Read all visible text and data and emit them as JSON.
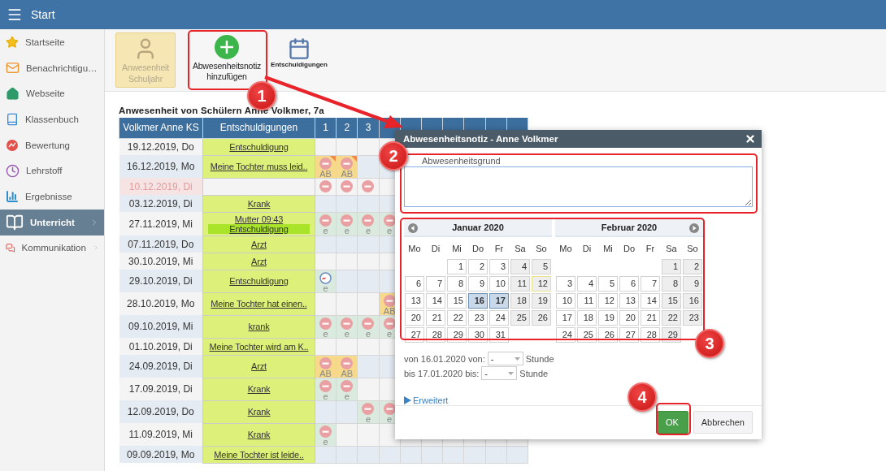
{
  "topbar": {
    "title": "Start"
  },
  "sidebar": {
    "items": [
      {
        "label": "Startseite",
        "selected": false,
        "has_submenu": false
      },
      {
        "label": "Benachrichtigu…",
        "selected": false,
        "has_submenu": false
      },
      {
        "label": "Webseite",
        "selected": false,
        "has_submenu": false
      },
      {
        "label": "Klassenbuch",
        "selected": false,
        "has_submenu": false
      },
      {
        "label": "Bewertung",
        "selected": false,
        "has_submenu": false
      },
      {
        "label": "Lehrstoff",
        "selected": false,
        "has_submenu": false
      },
      {
        "label": "Ergebnisse",
        "selected": false,
        "has_submenu": false
      },
      {
        "label": "Unterricht",
        "selected": true,
        "has_submenu": true
      },
      {
        "label": "Kommunikation",
        "selected": false,
        "has_submenu": true
      }
    ]
  },
  "toolbar": {
    "buttons": [
      {
        "lines": [
          "Anwesenheit",
          "Schuljahr"
        ],
        "disabled": true
      },
      {
        "lines": [
          "Abwesenheitsnotiz",
          "hinzufügen"
        ],
        "disabled": false
      },
      {
        "lines": [
          "Entschuldigungen"
        ],
        "disabled": false
      }
    ]
  },
  "table": {
    "title": "Anwesenheit von Schülern Anne Volkmer, 7a",
    "columns": [
      "Volkmer Anne KS",
      "Entschuldigungen"
    ],
    "periods": [
      "1",
      "2",
      "3"
    ],
    "rows": [
      {
        "date": "19.12.2019, Do",
        "flagged": false,
        "excuses": [
          {
            "text": "Entschuldigung",
            "highlighted": false
          }
        ]
      },
      {
        "date": "16.12.2019, Mo",
        "flagged": false,
        "excuses": [
          {
            "text": "Meine Tochter muss leid..",
            "highlighted": false
          }
        ],
        "marks": [
          {
            "kind": "absent",
            "color": "#f6d98b",
            "code": "AB",
            "note": true
          },
          {
            "kind": "absent",
            "color": "#f6d98b",
            "code": "AB",
            "note": true
          }
        ]
      },
      {
        "date": "10.12.2019, Di",
        "flagged": true,
        "marks": [
          {
            "kind": "absent"
          },
          {
            "kind": "absent"
          },
          {
            "kind": "absent"
          }
        ]
      },
      {
        "date": "03.12.2019, Di",
        "flagged": false,
        "excuses": [
          {
            "text": "Krank",
            "highlighted": false
          }
        ]
      },
      {
        "date": "27.11.2019, Mi",
        "flagged": false,
        "excuses": [
          {
            "text": "Mutter 09:43",
            "highlighted": false
          },
          {
            "text": "Entschuldigung",
            "highlighted": true
          }
        ],
        "marks": [
          {
            "kind": "absent",
            "color": "#dbeadf",
            "code": "e",
            "note": false
          },
          {
            "kind": "absent",
            "color": "#dbeadf",
            "code": "e",
            "note": false
          },
          {
            "kind": "absent",
            "color": "#dbeadf",
            "code": "e",
            "note": false
          },
          {
            "kind": "absent",
            "color": "#dbeadf",
            "code": "e",
            "note": false
          }
        ]
      },
      {
        "date": "07.11.2019, Do",
        "flagged": false,
        "excuses": [
          {
            "text": "Arzt",
            "highlighted": false
          }
        ]
      },
      {
        "date": "30.10.2019, Mi",
        "flagged": false,
        "excuses": [
          {
            "text": "Arzt",
            "highlighted": false
          }
        ]
      },
      {
        "date": "29.10.2019, Di",
        "flagged": false,
        "excuses": [
          {
            "text": "Entschuldigung",
            "highlighted": false
          }
        ],
        "marks": [
          {
            "kind": "late",
            "color": "#dbeadf",
            "code": "e",
            "note": false
          }
        ]
      },
      {
        "date": "28.10.2019, Mo",
        "flagged": false,
        "excuses": [
          {
            "text": "Meine Tochter hat einen..",
            "highlighted": false
          }
        ],
        "marks": [
          {
            "kind": "empty"
          },
          {
            "kind": "empty"
          },
          {
            "kind": "empty"
          },
          {
            "kind": "absent",
            "color": "#f6d98b",
            "code": "AB",
            "note": false
          }
        ]
      },
      {
        "date": "09.10.2019, Mi",
        "flagged": false,
        "excuses": [
          {
            "text": "krank",
            "highlighted": false
          }
        ],
        "marks": [
          {
            "kind": "absent",
            "color": "#dbeadf",
            "code": "e",
            "note": false
          },
          {
            "kind": "absent",
            "color": "#dbeadf",
            "code": "e",
            "note": false
          },
          {
            "kind": "absent",
            "color": "#dbeadf",
            "code": "e",
            "note": false
          },
          {
            "kind": "absent",
            "color": "#dbeadf",
            "code": "e",
            "note": false
          }
        ]
      },
      {
        "date": "01.10.2019, Di",
        "flagged": false,
        "excuses": [
          {
            "text": "Meine Tochter wird am K..",
            "highlighted": false
          }
        ]
      },
      {
        "date": "24.09.2019, Di",
        "flagged": false,
        "excuses": [
          {
            "text": "Arzt",
            "highlighted": false
          }
        ],
        "marks": [
          {
            "kind": "absent",
            "color": "#f6d98b",
            "code": "AB",
            "note": false
          },
          {
            "kind": "absent",
            "color": "#f6d98b",
            "code": "AB",
            "note": false
          }
        ]
      },
      {
        "date": "17.09.2019, Di",
        "flagged": false,
        "excuses": [
          {
            "text": "Krank",
            "highlighted": false
          }
        ],
        "marks": [
          {
            "kind": "absent",
            "color": "#dbeadf",
            "code": "e",
            "note": false
          },
          {
            "kind": "absent",
            "color": "#dbeadf",
            "code": "e",
            "note": false
          }
        ]
      },
      {
        "date": "12.09.2019, Do",
        "flagged": false,
        "excuses": [
          {
            "text": "Krank",
            "highlighted": false
          }
        ],
        "marks": [
          {
            "kind": "empty"
          },
          {
            "kind": "empty"
          },
          {
            "kind": "absent",
            "color": "#dbeadf",
            "code": "e",
            "note": false
          },
          {
            "kind": "absent",
            "color": "#dbeadf",
            "code": "e",
            "note": false
          }
        ]
      },
      {
        "date": "11.09.2019, Mi",
        "flagged": false,
        "excuses": [
          {
            "text": "Krank",
            "highlighted": false
          }
        ],
        "marks": [
          {
            "kind": "absent",
            "color": "#dbeadf",
            "code": "e",
            "note": false
          }
        ]
      },
      {
        "date": "09.09.2019, Mo",
        "flagged": false,
        "excuses": [
          {
            "text": "Meine Tochter ist leide..",
            "highlighted": false
          }
        ]
      }
    ]
  },
  "dialog": {
    "title": "Abwesenheitsnotiz - Anne Volkmer",
    "reason_label": "Abwesenheitsgrund",
    "calendar": {
      "months": [
        {
          "title": "Januar 2020",
          "weekdays": [
            "Mo",
            "Di",
            "Mi",
            "Do",
            "Fr",
            "Sa",
            "So"
          ],
          "weeks": [
            [
              {
                "kind": "blank"
              },
              {
                "kind": "blank"
              },
              {
                "kind": "day",
                "day": "1",
                "selected": false,
                "today": false
              },
              {
                "kind": "day",
                "day": "2",
                "selected": false,
                "today": false
              },
              {
                "kind": "day",
                "day": "3",
                "selected": false,
                "today": false
              },
              {
                "kind": "day",
                "day": "4",
                "selected": false,
                "today": false
              },
              {
                "kind": "day",
                "day": "5",
                "selected": false,
                "today": false
              }
            ],
            [
              {
                "kind": "day",
                "day": "6",
                "selected": false,
                "today": false
              },
              {
                "kind": "day",
                "day": "7",
                "selected": false,
                "today": false
              },
              {
                "kind": "day",
                "day": "8",
                "selected": false,
                "today": false
              },
              {
                "kind": "day",
                "day": "9",
                "selected": false,
                "today": false
              },
              {
                "kind": "day",
                "day": "10",
                "selected": false,
                "today": false
              },
              {
                "kind": "day",
                "day": "11",
                "selected": false,
                "today": false
              },
              {
                "kind": "day",
                "day": "12",
                "selected": false,
                "today": true
              }
            ],
            [
              {
                "kind": "day",
                "day": "13",
                "selected": false,
                "today": false
              },
              {
                "kind": "day",
                "day": "14",
                "selected": false,
                "today": false
              },
              {
                "kind": "day",
                "day": "15",
                "selected": false,
                "today": false
              },
              {
                "kind": "day",
                "day": "16",
                "selected": true,
                "today": false
              },
              {
                "kind": "day",
                "day": "17",
                "selected": true,
                "today": false
              },
              {
                "kind": "day",
                "day": "18",
                "selected": false,
                "today": false
              },
              {
                "kind": "day",
                "day": "19",
                "selected": false,
                "today": false
              }
            ],
            [
              {
                "kind": "day",
                "day": "20",
                "selected": false,
                "today": false
              },
              {
                "kind": "day",
                "day": "21",
                "selected": false,
                "today": false
              },
              {
                "kind": "day",
                "day": "22",
                "selected": false,
                "today": false
              },
              {
                "kind": "day",
                "day": "23",
                "selected": false,
                "today": false
              },
              {
                "kind": "day",
                "day": "24",
                "selected": false,
                "today": false
              },
              {
                "kind": "day",
                "day": "25",
                "selected": false,
                "today": false
              },
              {
                "kind": "day",
                "day": "26",
                "selected": false,
                "today": false
              }
            ],
            [
              {
                "kind": "day",
                "day": "27",
                "selected": false,
                "today": false
              },
              {
                "kind": "day",
                "day": "28",
                "selected": false,
                "today": false
              },
              {
                "kind": "day",
                "day": "29",
                "selected": false,
                "today": false
              },
              {
                "kind": "day",
                "day": "30",
                "selected": false,
                "today": false
              },
              {
                "kind": "day",
                "day": "31",
                "selected": false,
                "today": false
              },
              {
                "kind": "blank"
              },
              {
                "kind": "blank"
              }
            ]
          ]
        },
        {
          "title": "Februar 2020",
          "weekdays": [
            "Mo",
            "Di",
            "Mi",
            "Do",
            "Fr",
            "Sa",
            "So"
          ],
          "weeks": [
            [
              {
                "kind": "blank"
              },
              {
                "kind": "blank"
              },
              {
                "kind": "blank"
              },
              {
                "kind": "blank"
              },
              {
                "kind": "blank"
              },
              {
                "kind": "day",
                "day": "1",
                "selected": false,
                "today": false
              },
              {
                "kind": "day",
                "day": "2",
                "selected": false,
                "today": false
              }
            ],
            [
              {
                "kind": "day",
                "day": "3",
                "selected": false,
                "today": false
              },
              {
                "kind": "day",
                "day": "4",
                "selected": false,
                "today": false
              },
              {
                "kind": "day",
                "day": "5",
                "selected": false,
                "today": false
              },
              {
                "kind": "day",
                "day": "6",
                "selected": false,
                "today": false
              },
              {
                "kind": "day",
                "day": "7",
                "selected": false,
                "today": false
              },
              {
                "kind": "day",
                "day": "8",
                "selected": false,
                "today": false
              },
              {
                "kind": "day",
                "day": "9",
                "selected": false,
                "today": false
              }
            ],
            [
              {
                "kind": "day",
                "day": "10",
                "selected": false,
                "today": false
              },
              {
                "kind": "day",
                "day": "11",
                "selected": false,
                "today": false
              },
              {
                "kind": "day",
                "day": "12",
                "selected": false,
                "today": false
              },
              {
                "kind": "day",
                "day": "13",
                "selected": false,
                "today": false
              },
              {
                "kind": "day",
                "day": "14",
                "selected": false,
                "today": false
              },
              {
                "kind": "day",
                "day": "15",
                "selected": false,
                "today": false
              },
              {
                "kind": "day",
                "day": "16",
                "selected": false,
                "today": false
              }
            ],
            [
              {
                "kind": "day",
                "day": "17",
                "selected": false,
                "today": false
              },
              {
                "kind": "day",
                "day": "18",
                "selected": false,
                "today": false
              },
              {
                "kind": "day",
                "day": "19",
                "selected": false,
                "today": false
              },
              {
                "kind": "day",
                "day": "20",
                "selected": false,
                "today": false
              },
              {
                "kind": "day",
                "day": "21",
                "selected": false,
                "today": false
              },
              {
                "kind": "day",
                "day": "22",
                "selected": false,
                "today": false
              },
              {
                "kind": "day",
                "day": "23",
                "selected": false,
                "today": false
              }
            ],
            [
              {
                "kind": "day",
                "day": "24",
                "selected": false,
                "today": false
              },
              {
                "kind": "day",
                "day": "25",
                "selected": false,
                "today": false
              },
              {
                "kind": "day",
                "day": "26",
                "selected": false,
                "today": false
              },
              {
                "kind": "day",
                "day": "27",
                "selected": false,
                "today": false
              },
              {
                "kind": "day",
                "day": "28",
                "selected": false,
                "today": false
              },
              {
                "kind": "day",
                "day": "29",
                "selected": false,
                "today": false
              },
              {
                "kind": "blank"
              }
            ]
          ]
        }
      ]
    },
    "range": [
      {
        "prefix": "von 16.01.2020 von:",
        "value": "-",
        "suffix": "Stunde"
      },
      {
        "prefix": "bis 17.01.2020 bis:",
        "value": "-",
        "suffix": "Stunde"
      }
    ],
    "advanced_link": "Erweitert",
    "buttons": [
      {
        "label": "OK",
        "kind": "primary"
      },
      {
        "label": "Abbrechen",
        "kind": "secondary"
      }
    ]
  },
  "callouts": [
    {
      "label": "1"
    },
    {
      "label": "2"
    },
    {
      "label": "3"
    },
    {
      "label": "4"
    }
  ]
}
